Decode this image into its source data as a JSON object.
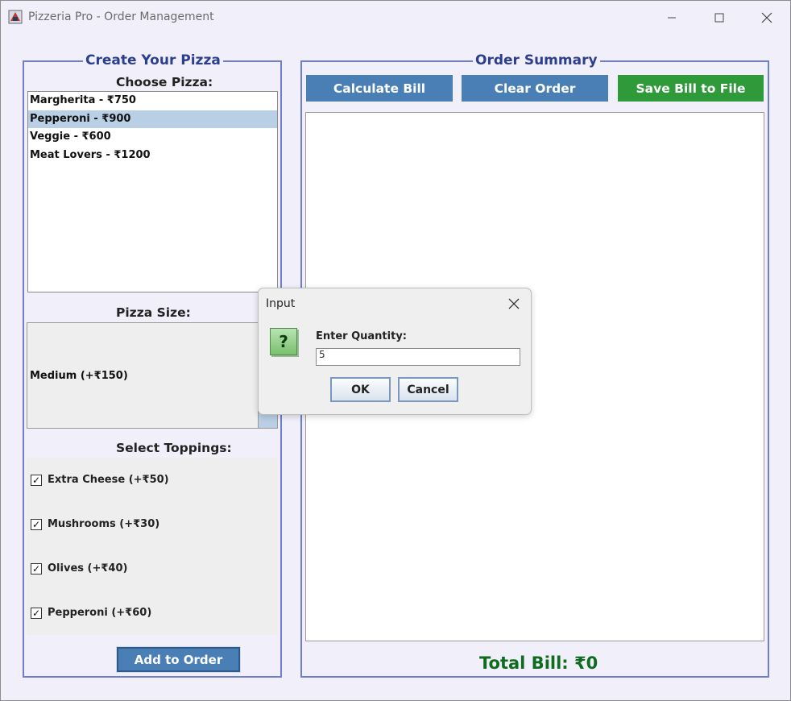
{
  "window": {
    "title": "Pizzeria Pro - Order Management"
  },
  "left_panel": {
    "title": "Create Your Pizza",
    "choose_label": "Choose Pizza:",
    "pizzas": [
      {
        "label": "Margherita - ₹750",
        "selected": false
      },
      {
        "label": "Pepperoni - ₹900",
        "selected": true
      },
      {
        "label": "Veggie - ₹600",
        "selected": false
      },
      {
        "label": "Meat Lovers - ₹1200",
        "selected": false
      }
    ],
    "size_label": "Pizza Size:",
    "size_value": "Medium (+₹150)",
    "toppings_label": "Select Toppings:",
    "toppings": [
      {
        "label": "Extra Cheese (+₹50)",
        "checked": true
      },
      {
        "label": "Mushrooms (+₹30)",
        "checked": true
      },
      {
        "label": "Olives (+₹40)",
        "checked": true
      },
      {
        "label": "Pepperoni (+₹60)",
        "checked": true
      }
    ],
    "add_button": "Add to Order"
  },
  "right_panel": {
    "title": "Order Summary",
    "calc_button": "Calculate Bill",
    "clear_button": "Clear Order",
    "save_button": "Save Bill to File",
    "summary_text": "",
    "total": "Total Bill: ₹0"
  },
  "dialog": {
    "title": "Input",
    "prompt": "Enter Quantity:",
    "value": "5",
    "ok": "OK",
    "cancel": "Cancel"
  },
  "colors": {
    "accent_blue": "#4a7fb5",
    "save_green": "#2e9a3a",
    "total_green": "#0f6b1f",
    "panel_border": "#6e7fcf"
  }
}
